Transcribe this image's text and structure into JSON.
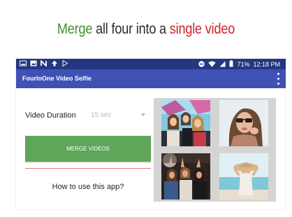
{
  "headline": {
    "part1": "Merge",
    "part2": " all four into a ",
    "part3": "single video"
  },
  "statusbar": {
    "left_icons": [
      "gallery-icon",
      "image-icon",
      "n-icon",
      "upload-icon",
      "play-store-icon"
    ],
    "right_icons": [
      "dnd-icon",
      "wifi-icon",
      "signal-icon"
    ],
    "battery": "71%",
    "time": "12:18 PM"
  },
  "appbar": {
    "title": "FourInOne Video Selfie"
  },
  "form": {
    "duration_label": "Video Duration",
    "duration_value": "15 sec",
    "merge_button": "MERGE VIDEOS",
    "howto_link": "How to use this app?"
  },
  "thumbnails": [
    "friends-selfie-thumbnail",
    "woman-sunglasses-thumbnail",
    "concert-crowd-thumbnail",
    "beach-hat-thumbnail"
  ],
  "colors": {
    "status_bar": "#23367f",
    "app_bar": "#3f51b5",
    "button": "#5fa55a",
    "divider": "#e8728a",
    "headline_green": "#3f8d2e",
    "headline_red": "#d0202a"
  }
}
